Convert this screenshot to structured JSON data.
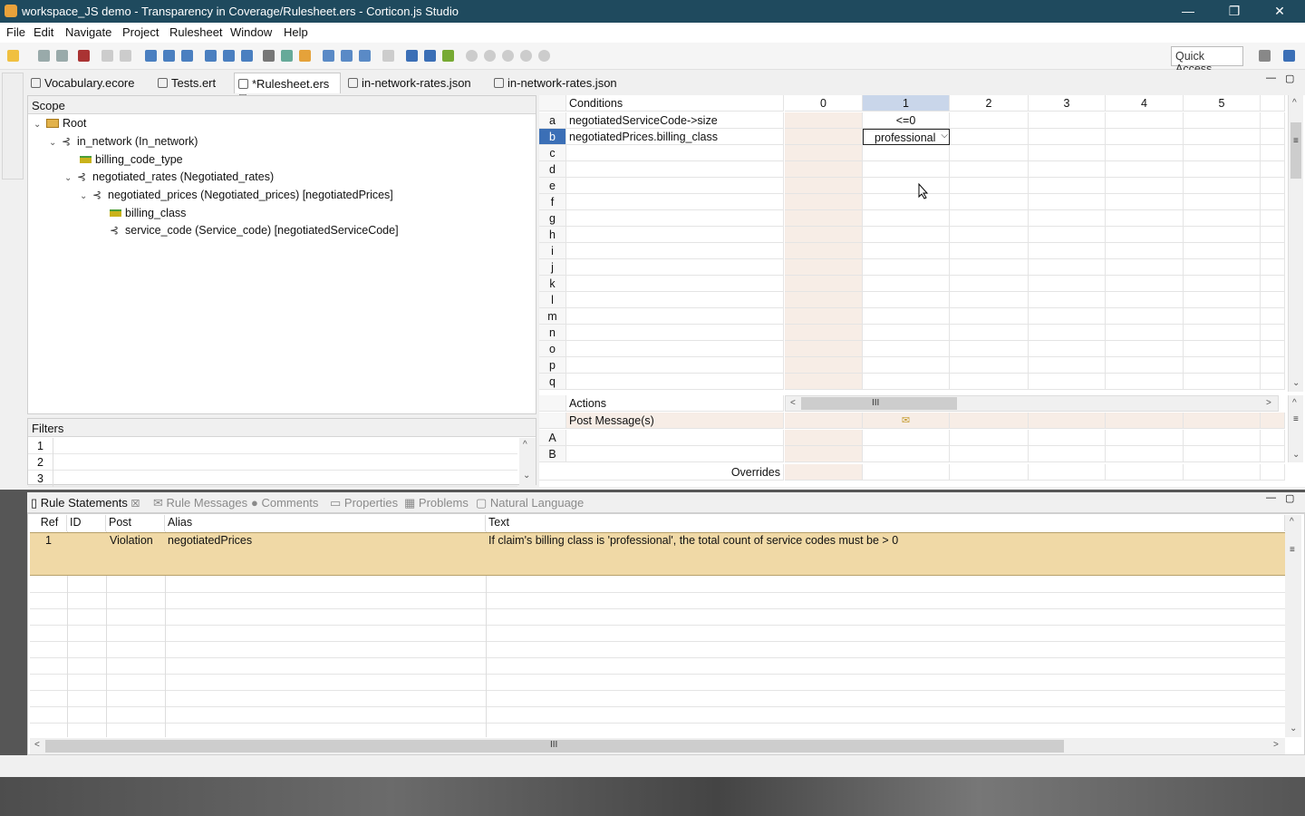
{
  "window": {
    "title": "workspace_JS demo - Transparency in Coverage/Rulesheet.ers - Corticon.js Studio",
    "minimize": "—",
    "restore": "❐",
    "close": "✕"
  },
  "menubar": [
    "File",
    "Edit",
    "Navigate",
    "Project",
    "Rulesheet",
    "Window",
    "Help"
  ],
  "toolbar": {
    "quick_access": "Quick Access"
  },
  "editor_tabs": [
    {
      "label": "Vocabulary.ecore"
    },
    {
      "label": "Tests.ert"
    },
    {
      "label": "*Rulesheet.ers",
      "close": "☒"
    },
    {
      "label": "in-network-rates.json"
    },
    {
      "label": "in-network-rates.json"
    }
  ],
  "scope": {
    "header": "Scope",
    "nodes": [
      "Root",
      "in_network (In_network)",
      "billing_code_type",
      "negotiated_rates (Negotiated_rates)",
      "negotiated_prices (Negotiated_prices) [negotiatedPrices]",
      "billing_class",
      "service_code (Service_code) [negotiatedServiceCode]"
    ]
  },
  "filters": {
    "header": "Filters",
    "rows": [
      "1",
      "2",
      "3"
    ]
  },
  "rulesheet": {
    "conditions_header": "Conditions",
    "columns": [
      "0",
      "1",
      "2",
      "3",
      "4",
      "5"
    ],
    "condition_rows": [
      "a",
      "b",
      "c",
      "d",
      "e",
      "f",
      "g",
      "h",
      "i",
      "j",
      "k",
      "l",
      "m",
      "n",
      "o",
      "p",
      "q"
    ],
    "conditions": [
      "negotiatedServiceCode->size",
      "negotiatedPrices.billing_class"
    ],
    "rule1_values": [
      "<=0",
      "professional"
    ],
    "actions_header": "Actions",
    "post_message": "Post Message(s)",
    "action_rows": [
      "A",
      "B"
    ],
    "overrides": "Overrides"
  },
  "bottom_tabs": [
    {
      "label": "Rule Statements",
      "close": "☒"
    },
    {
      "label": "Rule Messages"
    },
    {
      "label": "Comments"
    },
    {
      "label": "Properties"
    },
    {
      "label": "Problems"
    },
    {
      "label": "Natural Language"
    }
  ],
  "rule_statements": {
    "headers": [
      "Ref",
      "ID",
      "Post",
      "Alias",
      "Text"
    ],
    "rows": [
      {
        "ref": "1",
        "id": "",
        "post": "Violation",
        "alias": "negotiatedPrices",
        "text": "If claim's billing class is 'professional', the total count of service codes must be > 0"
      }
    ]
  },
  "glyphs": {
    "twist_open": "⌄",
    "assoc": "⊰",
    "left": "<",
    "right": ">",
    "up": "^",
    "down": "⌄",
    "grip": "III",
    "menu_lines": "≡",
    "envelope": "✉",
    "dropdown": "⌵",
    "view_min": "—",
    "view_max": "▢"
  }
}
